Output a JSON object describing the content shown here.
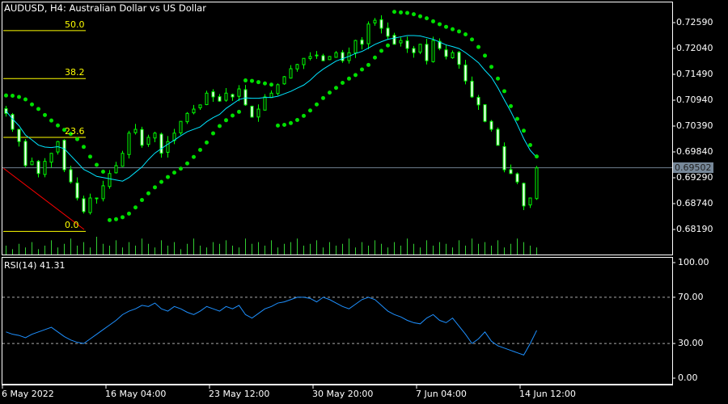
{
  "header": {
    "title": "AUDUSD, H4:  Australian Dollar vs US Dollar"
  },
  "price_axis": {
    "labels": [
      "0.72590",
      "0.72040",
      "0.71490",
      "0.70940",
      "0.70390",
      "0.69840",
      "0.69290",
      "0.68740",
      "0.68190"
    ],
    "current": "0.69502"
  },
  "rsi": {
    "title": "RSI(14) 41.31",
    "axis_labels": [
      "100.00",
      "70.00",
      "30.00",
      "0.00"
    ],
    "values": [
      40,
      38,
      37,
      35,
      38,
      40,
      42,
      44,
      40,
      36,
      33,
      31,
      30,
      34,
      38,
      42,
      46,
      50,
      55,
      58,
      60,
      63,
      62,
      65,
      60,
      58,
      62,
      60,
      57,
      55,
      58,
      62,
      60,
      58,
      62,
      60,
      63,
      55,
      52,
      56,
      60,
      62,
      65,
      66,
      68,
      70,
      70,
      69,
      66,
      70,
      68,
      65,
      62,
      60,
      64,
      68,
      70,
      68,
      63,
      58,
      55,
      53,
      50,
      48,
      47,
      52,
      55,
      50,
      48,
      52,
      45,
      38,
      30,
      34,
      40,
      32,
      28,
      26,
      24,
      22,
      20,
      30,
      41.31
    ]
  },
  "fib": {
    "levels": [
      "50.0",
      "38.2",
      "23.6",
      "0.0"
    ],
    "prices": [
      0.7242,
      0.714,
      0.7015,
      0.6815
    ]
  },
  "time_axis": [
    "6 May 2022",
    "16 May 04:00",
    "23 May 12:00",
    "30 May 20:00",
    "7 Jun 04:00",
    "14 Jun 12:00"
  ],
  "colors": {
    "candle": "#00ff00",
    "ma": "#00e5ff",
    "sar": "#00e000",
    "fib": "#ffff00",
    "trend": "#ff0000",
    "rsi": "#1e90ff",
    "grid": "#708090"
  },
  "chart_data": {
    "type": "candlestick",
    "symbol": "AUDUSD",
    "timeframe": "H4",
    "ylim": [
      0.6792,
      0.7292
    ],
    "closes": [
      0.7066,
      0.7032,
      0.7006,
      0.6955,
      0.6964,
      0.6938,
      0.6964,
      0.6981,
      0.7006,
      0.6946,
      0.692,
      0.6886,
      0.6857,
      0.6886,
      0.6886,
      0.6912,
      0.6938,
      0.6955,
      0.6981,
      0.7024,
      0.7032,
      0.6998,
      0.7015,
      0.7024,
      0.6981,
      0.7006,
      0.7024,
      0.7049,
      0.7066,
      0.7075,
      0.7084,
      0.7109,
      0.7101,
      0.7092,
      0.7109,
      0.7101,
      0.7118,
      0.7084,
      0.7058,
      0.7075,
      0.7101,
      0.7109,
      0.7127,
      0.7144,
      0.7161,
      0.717,
      0.7183,
      0.7187,
      0.719,
      0.7178,
      0.7187,
      0.7195,
      0.7178,
      0.7195,
      0.7221,
      0.7213,
      0.7256,
      0.7264,
      0.7247,
      0.723,
      0.7213,
      0.7221,
      0.7204,
      0.7195,
      0.7213,
      0.7178,
      0.7221,
      0.7204,
      0.7187,
      0.7195,
      0.717,
      0.7135,
      0.7101,
      0.7084,
      0.7049,
      0.7032,
      0.6998,
      0.6946,
      0.6938,
      0.692,
      0.6869,
      0.6886,
      0.695
    ],
    "volumes": [
      5,
      3,
      6,
      4,
      7,
      3,
      5,
      8,
      4,
      6,
      9,
      5,
      7,
      4,
      10,
      6,
      5,
      8,
      4,
      7,
      5,
      9,
      6,
      4,
      8,
      5,
      7,
      3,
      6,
      9,
      5,
      4,
      7,
      6,
      8,
      5,
      4,
      9,
      6,
      7,
      5,
      8,
      4,
      6,
      7,
      9,
      5,
      6,
      8,
      4,
      7,
      5,
      6,
      9,
      4,
      7,
      5,
      8,
      6,
      4,
      7,
      5,
      9,
      6,
      4,
      8,
      5,
      7,
      6,
      4,
      8,
      5,
      9,
      6,
      7,
      5,
      8,
      4,
      6,
      9,
      7,
      5,
      4
    ]
  }
}
